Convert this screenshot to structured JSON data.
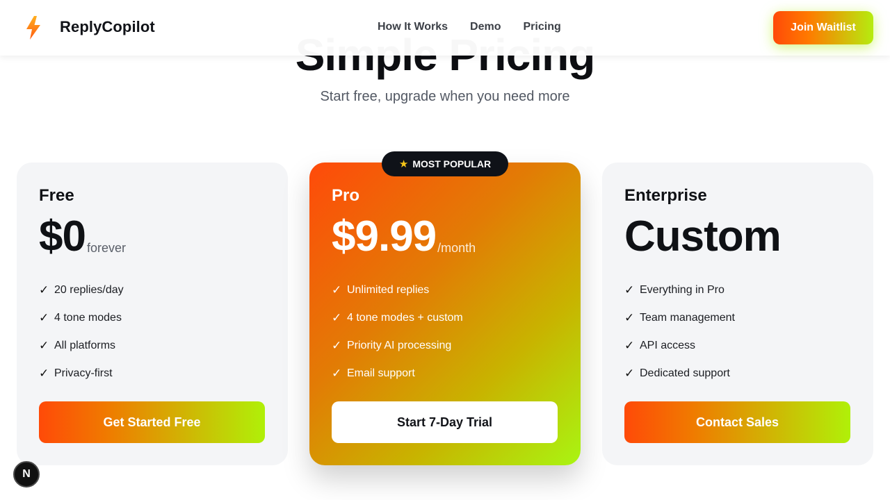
{
  "header": {
    "brand": "ReplyCopilot",
    "logo_icon": "lightning-bolt-icon",
    "nav": [
      "How It Works",
      "Demo",
      "Pricing"
    ],
    "cta_label": "Join Waitlist"
  },
  "section": {
    "title": "Simple Pricing",
    "subtitle": "Start free, upgrade when you need more"
  },
  "plans": [
    {
      "name": "Free",
      "price": "$0",
      "suffix": "forever",
      "features": [
        "20 replies/day",
        "4 tone modes",
        "All platforms",
        "Privacy-first"
      ],
      "button": "Get Started Free"
    },
    {
      "name": "Pro",
      "price": "$9.99",
      "suffix": "/month",
      "badge": "MOST POPULAR",
      "features": [
        "Unlimited replies",
        "4 tone modes + custom",
        "Priority AI processing",
        "Email support"
      ],
      "button": "Start 7-Day Trial"
    },
    {
      "name": "Enterprise",
      "price": "Custom",
      "suffix": "",
      "features": [
        "Everything in Pro",
        "Team management",
        "API access",
        "Dedicated support"
      ],
      "button": "Contact Sales"
    }
  ],
  "check_symbol": "✓",
  "dev_button": "N",
  "colors": {
    "accent_orange": "#ff4a08",
    "accent_lime": "#b0f008",
    "dark": "#0f1218"
  }
}
